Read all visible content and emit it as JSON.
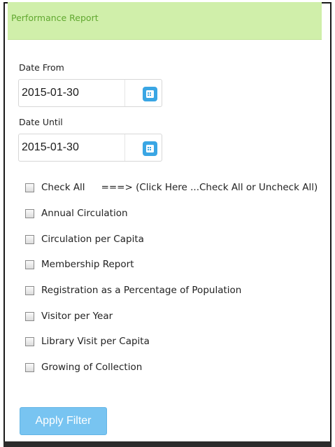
{
  "header": {
    "title": "Performance Report"
  },
  "filters": {
    "date_from": {
      "label": "Date From",
      "value": "2015-01-30"
    },
    "date_until": {
      "label": "Date Until",
      "value": "2015-01-30"
    },
    "check_all": {
      "label": "Check All",
      "hint": "===> (Click Here ...Check All or Uncheck All)",
      "checked": false
    },
    "reports": [
      {
        "label": "Annual Circulation",
        "checked": false
      },
      {
        "label": "Circulation per Capita",
        "checked": false
      },
      {
        "label": "Membership Report",
        "checked": false
      },
      {
        "label": "Registration as a Percentage of Population",
        "checked": false
      },
      {
        "label": "Visitor per Year",
        "checked": false
      },
      {
        "label": "Library Visit per Capita",
        "checked": false
      },
      {
        "label": "Growing of Collection",
        "checked": false
      }
    ]
  },
  "actions": {
    "apply_label": "Apply Filter"
  },
  "icons": {
    "calendar": "calendar-icon"
  },
  "colors": {
    "header_bg": "#d0efaa",
    "header_text": "#61a830",
    "accent_blue": "#3aa6e4",
    "apply_button": "#78c4f1"
  }
}
